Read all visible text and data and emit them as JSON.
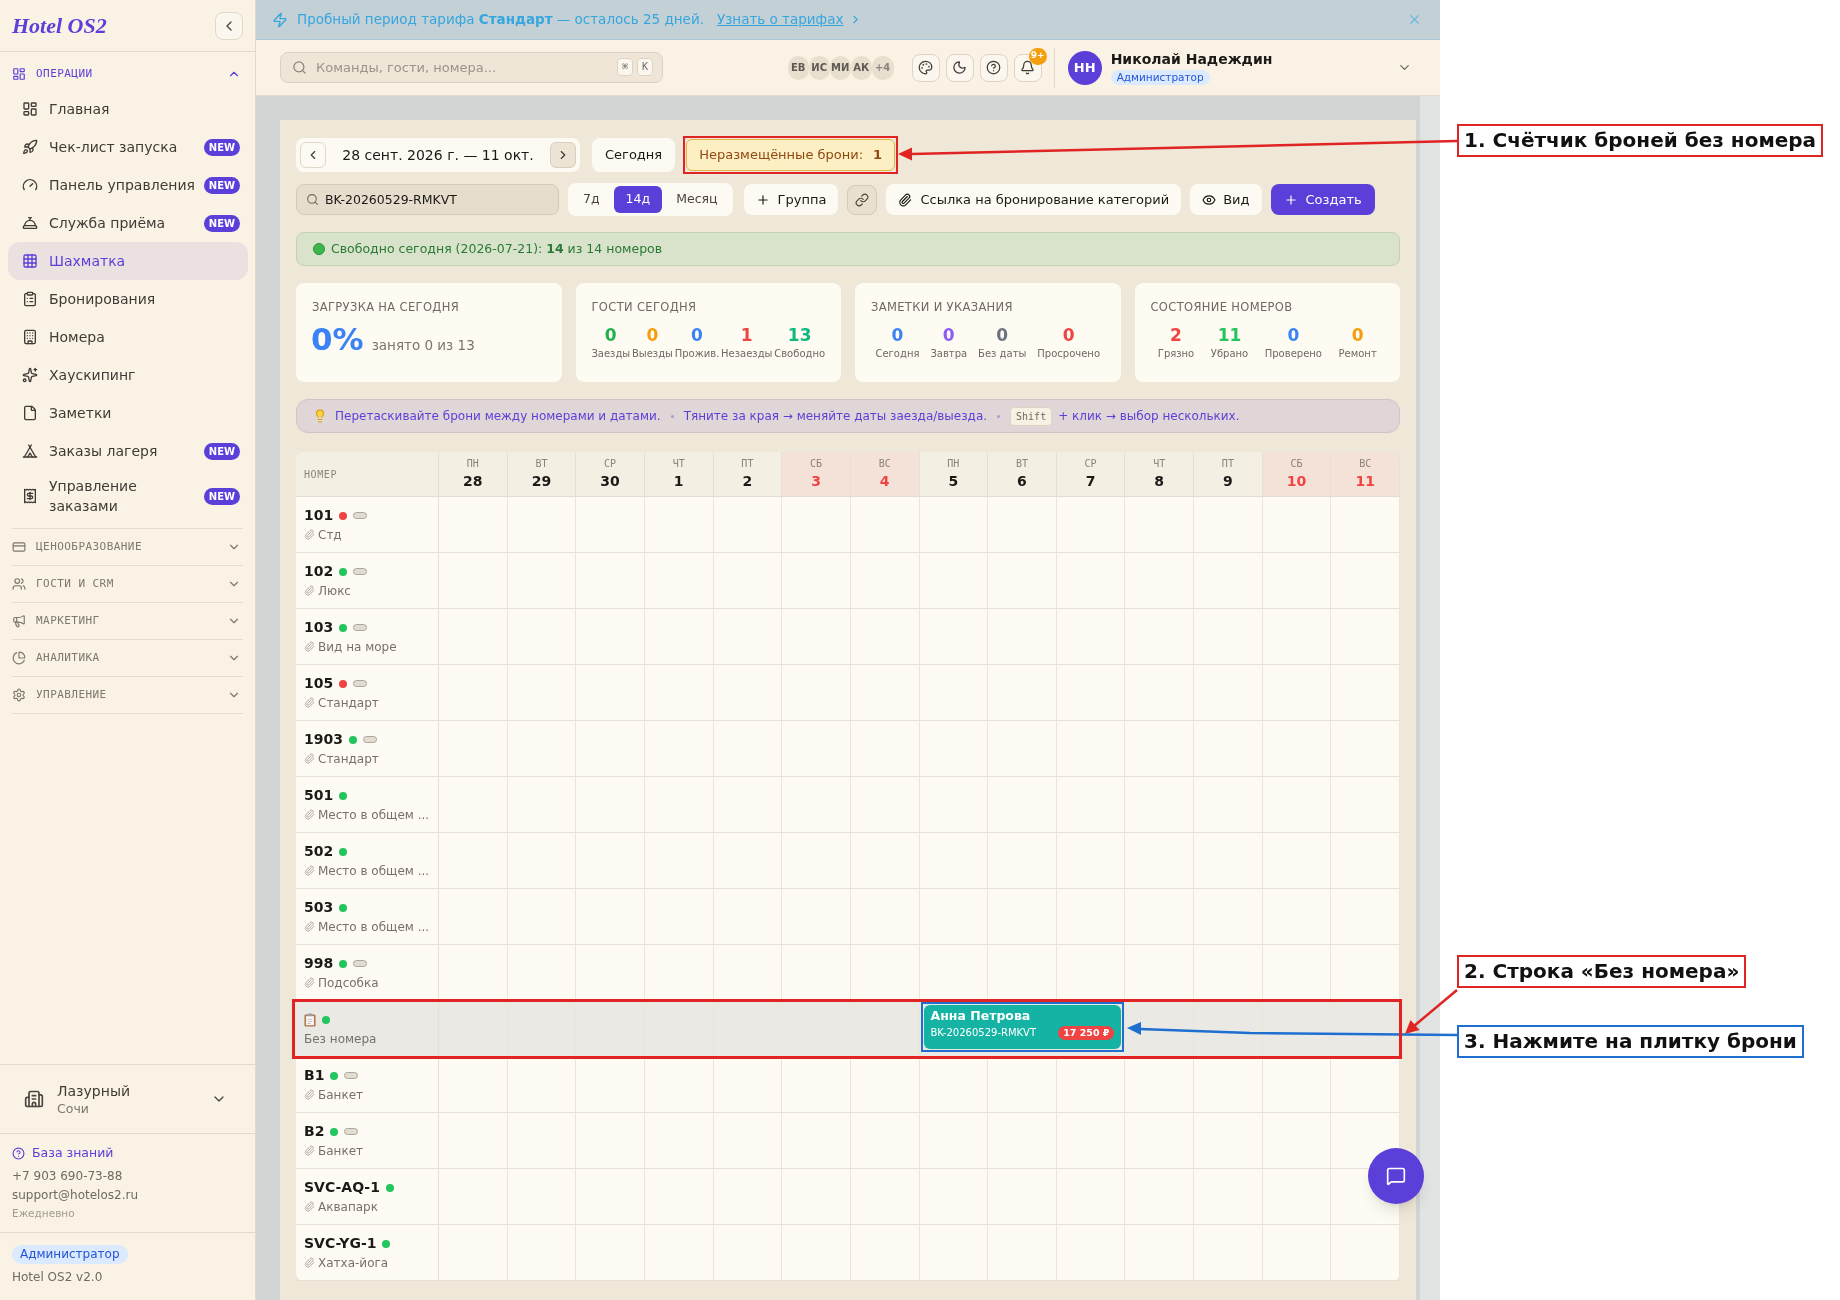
{
  "banner": {
    "text": "Пробный период тарифа **Стандарт** — осталось 25 дней.",
    "link": "Узнать о тарифах"
  },
  "sidebar": {
    "logo": "Hotel OS2",
    "sections": [
      {
        "label": "ОПЕРАЦИИ",
        "expanded": true,
        "items": [
          {
            "label": "Главная",
            "selected": false
          },
          {
            "label": "Чек-лист запуска",
            "badge": "NEW",
            "selected": false
          },
          {
            "label": "Панель управления",
            "badge": "NEW",
            "selected": false
          },
          {
            "label": "Служба приёма",
            "badge": "NEW",
            "selected": false
          },
          {
            "label": "Шахматка",
            "selected": true
          },
          {
            "label": "Бронирования",
            "selected": false
          },
          {
            "label": "Номера",
            "selected": false
          },
          {
            "label": "Хаускипинг",
            "selected": false
          },
          {
            "label": "Заметки",
            "selected": false
          },
          {
            "label": "Заказы лагеря",
            "badge": "NEW",
            "selected": false
          },
          {
            "label": "Управление заказами",
            "badge": "NEW",
            "selected": false
          }
        ]
      },
      {
        "label": "ЦЕНООБРАЗОВАНИЕ",
        "expanded": false
      },
      {
        "label": "ГОСТИ И CRM",
        "expanded": false
      },
      {
        "label": "МАРКЕТИНГ",
        "expanded": false
      },
      {
        "label": "АНАЛИТИКА",
        "expanded": false
      },
      {
        "label": "УПРАВЛЕНИЕ",
        "expanded": false
      }
    ],
    "property": {
      "name": "Лазурный",
      "city": "Сочи"
    },
    "support": {
      "link": "База знаний",
      "phone": "+7 903 690-73-88",
      "email": "support@hotelos2.ru",
      "hours": "Ежедневно"
    },
    "role": "Администратор",
    "version": "Hotel OS2 v2.0"
  },
  "header": {
    "search": {
      "placeholder": "Команды, гости, номера...",
      "keys": [
        "⌘",
        "K"
      ]
    },
    "presence": [
      "ЕВ",
      "ИС",
      "МИ",
      "АК"
    ],
    "presence_more": "+4",
    "notifications": "9+",
    "user": {
      "initials": "НН",
      "name": "Николай Надеждин",
      "role": "Администратор"
    }
  },
  "toolbar": {
    "date_range": "28 сент. 2026 г. — 11 окт.",
    "today": "Сегодня",
    "unplaced": {
      "label": "Неразмещённые брони:",
      "count": "1"
    },
    "search": {
      "value": "BK-20260529-RMKVT"
    },
    "ranges": [
      {
        "label": "7д",
        "selected": false
      },
      {
        "label": "14д",
        "selected": true
      },
      {
        "label": "Месяц",
        "selected": false
      }
    ],
    "group": "Группа",
    "category_link": "Ссылка на бронирование категорий",
    "view": "Вид",
    "create": "Создать"
  },
  "availability": "Свободно сегодня (2026-07-21): **14** из 14 номеров",
  "stats": [
    {
      "kind": "big",
      "title": "ЗАГРУЗКА НА СЕГОДНЯ",
      "value": "0%",
      "caption": "занято 0 из 13"
    },
    {
      "kind": "counts",
      "title": "ГОСТИ СЕГОДНЯ",
      "items": [
        {
          "value": "0",
          "label": "Заезды",
          "color": "#22b14c"
        },
        {
          "value": "0",
          "label": "Выезды",
          "color": "#f59e0b"
        },
        {
          "value": "0",
          "label": "Прожив.",
          "color": "#3b82f6"
        },
        {
          "value": "1",
          "label": "Незаезды",
          "color": "#ef4444"
        },
        {
          "value": "13",
          "label": "Свободно",
          "color": "#10b981"
        }
      ]
    },
    {
      "kind": "counts",
      "title": "ЗАМЕТКИ И УКАЗАНИЯ",
      "items": [
        {
          "value": "0",
          "label": "Сегодня",
          "color": "#3b82f6"
        },
        {
          "value": "0",
          "label": "Завтра",
          "color": "#8b5cf6"
        },
        {
          "value": "0",
          "label": "Без даты",
          "color": "#6b7280"
        },
        {
          "value": "0",
          "label": "Просрочено",
          "color": "#ef4444"
        }
      ]
    },
    {
      "kind": "counts",
      "title": "СОСТОЯНИЕ НОМЕРОВ",
      "items": [
        {
          "value": "2",
          "label": "Грязно",
          "color": "#ef4444"
        },
        {
          "value": "11",
          "label": "Убрано",
          "color": "#22c55e"
        },
        {
          "value": "0",
          "label": "Проверено",
          "color": "#3b82f6"
        },
        {
          "value": "0",
          "label": "Ремонт",
          "color": "#f59e0b"
        }
      ]
    }
  ],
  "hint": {
    "parts": [
      "Перетаскивайте брони между номерами и датами.",
      "Тяните за края → меняйте даты заезда/выезда."
    ],
    "key": "Shift",
    "tail": "+ клик → выбор нескольких."
  },
  "grid": {
    "room_header": "НОМЕР",
    "days": [
      {
        "weekday": "ПН",
        "date": "28",
        "weekend": false
      },
      {
        "weekday": "ВТ",
        "date": "29",
        "weekend": false
      },
      {
        "weekday": "СР",
        "date": "30",
        "weekend": false
      },
      {
        "weekday": "ЧТ",
        "date": "1",
        "weekend": false
      },
      {
        "weekday": "ПТ",
        "date": "2",
        "weekend": false
      },
      {
        "weekday": "СБ",
        "date": "3",
        "weekend": true
      },
      {
        "weekday": "ВС",
        "date": "4",
        "weekend": true
      },
      {
        "weekday": "ПН",
        "date": "5",
        "weekend": false
      },
      {
        "weekday": "ВТ",
        "date": "6",
        "weekend": false
      },
      {
        "weekday": "СР",
        "date": "7",
        "weekend": false
      },
      {
        "weekday": "ЧТ",
        "date": "8",
        "weekend": false
      },
      {
        "weekday": "ПТ",
        "date": "9",
        "weekend": false
      },
      {
        "weekday": "СБ",
        "date": "10",
        "weekend": true
      },
      {
        "weekday": "ВС",
        "date": "11",
        "weekend": true
      }
    ],
    "rows": [
      {
        "kind": "room",
        "number": "101",
        "category": "Стд",
        "color": "#ef4444",
        "indicator": true
      },
      {
        "kind": "room",
        "number": "102",
        "category": "Люкс",
        "color": "#22c55e",
        "indicator": true
      },
      {
        "kind": "room",
        "number": "103",
        "category": "Вид на море",
        "color": "#22c55e",
        "indicator": true
      },
      {
        "kind": "room",
        "number": "105",
        "category": "Стандарт",
        "color": "#ef4444",
        "indicator": true
      },
      {
        "kind": "room",
        "number": "1903",
        "category": "Стандарт",
        "color": "#22c55e",
        "indicator": true
      },
      {
        "kind": "room",
        "number": "501",
        "category": "Место в общем ...",
        "color": "#22c55e",
        "indicator": false
      },
      {
        "kind": "room",
        "number": "502",
        "category": "Место в общем ...",
        "color": "#22c55e",
        "indicator": false
      },
      {
        "kind": "room",
        "number": "503",
        "category": "Место в общем ...",
        "color": "#22c55e",
        "indicator": false
      },
      {
        "kind": "room",
        "number": "998",
        "category": "Подсобка",
        "color": "#22c55e",
        "indicator": true
      },
      {
        "kind": "unassigned",
        "label": "Без номера",
        "color": "#22c55e",
        "booking": {
          "guest": "Анна Петрова",
          "code": "BK-20260529-RMKVT",
          "price": "17 250 ₽"
        }
      },
      {
        "kind": "room",
        "number": "B1",
        "category": "Банкет",
        "color": "#22c55e",
        "indicator": true
      },
      {
        "kind": "room",
        "number": "B2",
        "category": "Банкет",
        "color": "#22c55e",
        "indicator": true
      },
      {
        "kind": "room",
        "number": "SVC-AQ-1",
        "category": "Аквапарк",
        "color": "#22c55e",
        "indicator": false
      },
      {
        "kind": "room",
        "number": "SVC-YG-1",
        "category": "Хатха-йога",
        "color": "#22c55e",
        "indicator": false
      }
    ]
  },
  "annotations": [
    {
      "text": "1. Счётчик броней без номера",
      "color": "#e02424"
    },
    {
      "text": "2. Строка «Без номера»",
      "color": "#e02424"
    },
    {
      "text": "3. Нажмите на плитку брони",
      "color": "#1e6fd0"
    }
  ]
}
